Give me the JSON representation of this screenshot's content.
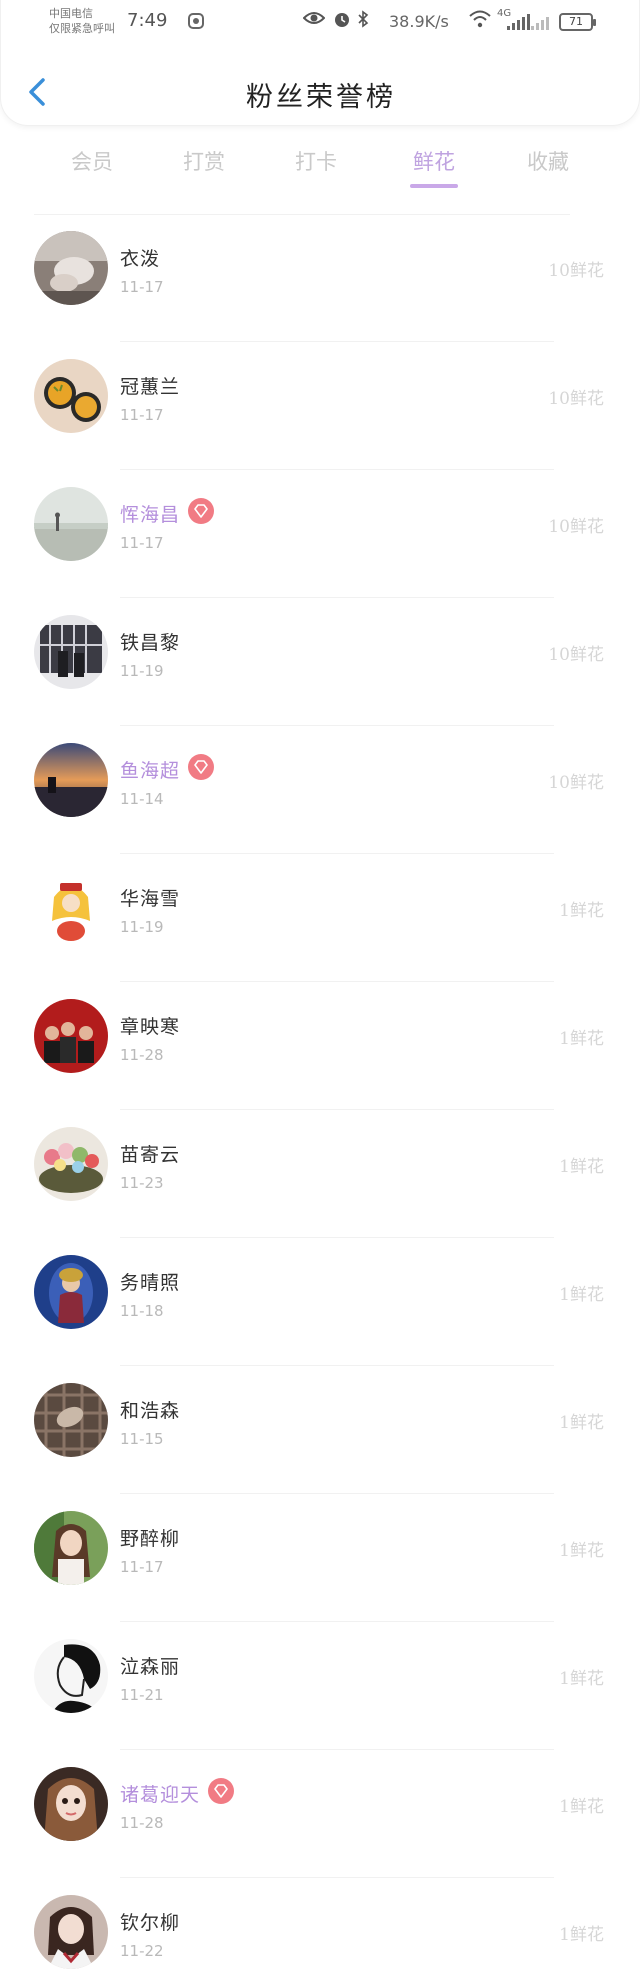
{
  "status_bar": {
    "carrier_line1": "中国电信",
    "carrier_line2": "仅限紧急呼叫",
    "time": "7:49",
    "net_speed": "38.9K/s",
    "net_type": "4G",
    "battery": "71"
  },
  "header": {
    "title": "粉丝荣誉榜"
  },
  "tabs": [
    {
      "label": "会员",
      "active": false
    },
    {
      "label": "打赏",
      "active": false
    },
    {
      "label": "打卡",
      "active": false
    },
    {
      "label": "鲜花",
      "active": true
    },
    {
      "label": "收藏",
      "active": false
    }
  ],
  "colors": {
    "accent": "#c9a8e8",
    "vip_name": "#b48fdc",
    "vip_badge": "#f17b84",
    "back_arrow": "#3a8fd9"
  },
  "fans": [
    {
      "name": "衣泼",
      "date": "11-17",
      "amount": "10鲜花",
      "vip": false,
      "avatar": "avatar-hands-icon"
    },
    {
      "name": "冠蕙兰",
      "date": "11-17",
      "amount": "10鲜花",
      "vip": false,
      "avatar": "avatar-cookies-icon"
    },
    {
      "name": "恽海昌",
      "date": "11-17",
      "amount": "10鲜花",
      "vip": true,
      "avatar": "avatar-beach-icon"
    },
    {
      "name": "铁昌黎",
      "date": "11-19",
      "amount": "10鲜花",
      "vip": false,
      "avatar": "avatar-window-icon"
    },
    {
      "name": "鱼海超",
      "date": "11-14",
      "amount": "10鲜花",
      "vip": true,
      "avatar": "avatar-sunset-icon"
    },
    {
      "name": "华海雪",
      "date": "11-19",
      "amount": "1鲜花",
      "vip": false,
      "avatar": "avatar-anime-icon"
    },
    {
      "name": "章映寒",
      "date": "11-28",
      "amount": "1鲜花",
      "vip": false,
      "avatar": "avatar-group-icon"
    },
    {
      "name": "苗寄云",
      "date": "11-23",
      "amount": "1鲜花",
      "vip": false,
      "avatar": "avatar-flowers-icon"
    },
    {
      "name": "务晴照",
      "date": "11-18",
      "amount": "1鲜花",
      "vip": false,
      "avatar": "avatar-portrait-icon"
    },
    {
      "name": "和浩森",
      "date": "11-15",
      "amount": "1鲜花",
      "vip": false,
      "avatar": "avatar-plaid-icon"
    },
    {
      "name": "野醉柳",
      "date": "11-17",
      "amount": "1鲜花",
      "vip": false,
      "avatar": "avatar-girl-icon"
    },
    {
      "name": "泣森丽",
      "date": "11-21",
      "amount": "1鲜花",
      "vip": false,
      "avatar": "avatar-sketch-icon"
    },
    {
      "name": "诸葛迎天",
      "date": "11-28",
      "amount": "1鲜花",
      "vip": true,
      "avatar": "avatar-doll-icon"
    },
    {
      "name": "钦尔柳",
      "date": "11-22",
      "amount": "1鲜花",
      "vip": false,
      "avatar": "avatar-uniform-icon"
    }
  ]
}
